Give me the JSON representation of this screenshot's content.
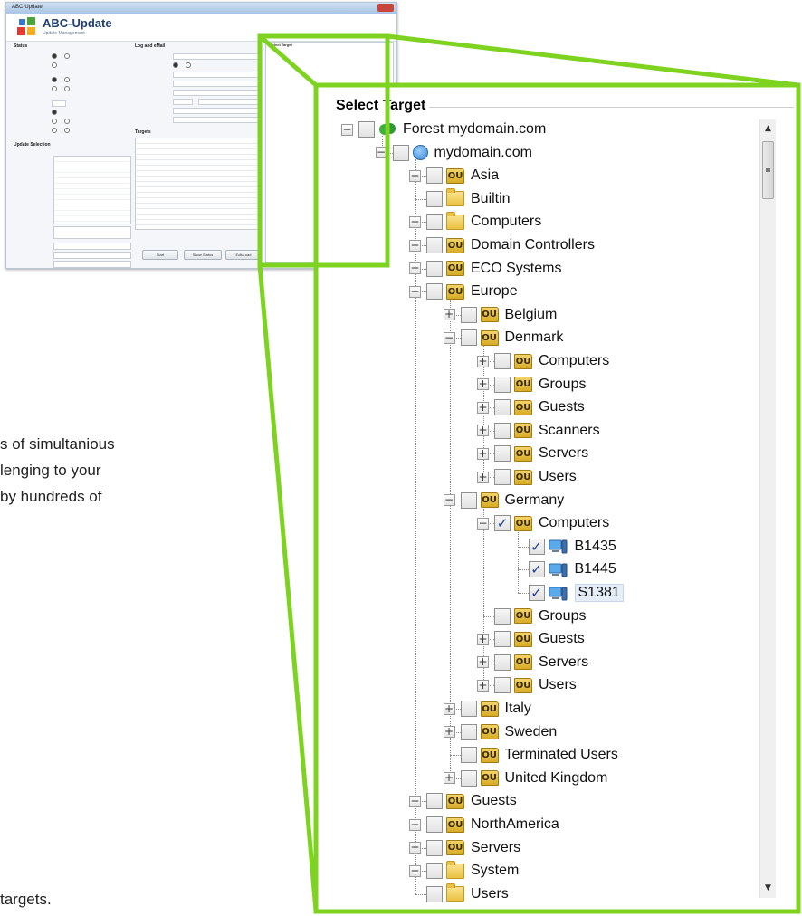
{
  "app": {
    "window_title": "ABC-Update",
    "title": "ABC-Update",
    "subtitle": "Update Management",
    "sections": {
      "status": "Status",
      "update_selection": "Update Selection",
      "log": "Log and eMail",
      "targets": "Targets",
      "target_tree": "Select Target"
    },
    "buttons": [
      "Start",
      "Show Status",
      "Edit/Load"
    ]
  },
  "background_text": {
    "line1": "s of simultanious",
    "line2": "lenging to your",
    "line3": "by hundreds of",
    "line4": "targets."
  },
  "panel": {
    "title": "Select Target"
  },
  "tree": [
    {
      "label": "Forest mydomain.com",
      "icon": "forest-tree-icon",
      "level": 0,
      "expander": "-",
      "checked": false
    },
    {
      "label": "mydomain.com",
      "icon": "domain-globe-icon",
      "level": 1,
      "expander": "-",
      "checked": false
    },
    {
      "label": "Asia",
      "icon": "ou-icon",
      "level": 2,
      "expander": "+",
      "checked": false
    },
    {
      "label": "Builtin",
      "icon": "folder-icon",
      "level": 2,
      "expander": "",
      "checked": false
    },
    {
      "label": "Computers",
      "icon": "folder-icon",
      "level": 2,
      "expander": "+",
      "checked": false
    },
    {
      "label": "Domain Controllers",
      "icon": "ou-icon",
      "level": 2,
      "expander": "+",
      "checked": false
    },
    {
      "label": "ECO Systems",
      "icon": "ou-icon",
      "level": 2,
      "expander": "+",
      "checked": false
    },
    {
      "label": "Europe",
      "icon": "ou-icon",
      "level": 2,
      "expander": "-",
      "checked": false
    },
    {
      "label": "Belgium",
      "icon": "ou-icon",
      "level": 3,
      "expander": "+",
      "checked": false
    },
    {
      "label": "Denmark",
      "icon": "ou-icon",
      "level": 3,
      "expander": "-",
      "checked": false
    },
    {
      "label": "Computers",
      "icon": "ou-icon",
      "level": 4,
      "expander": "+",
      "checked": false
    },
    {
      "label": "Groups",
      "icon": "ou-icon",
      "level": 4,
      "expander": "+",
      "checked": false
    },
    {
      "label": "Guests",
      "icon": "ou-icon",
      "level": 4,
      "expander": "+",
      "checked": false
    },
    {
      "label": "Scanners",
      "icon": "ou-icon",
      "level": 4,
      "expander": "+",
      "checked": false
    },
    {
      "label": "Servers",
      "icon": "ou-icon",
      "level": 4,
      "expander": "+",
      "checked": false
    },
    {
      "label": "Users",
      "icon": "ou-icon",
      "level": 4,
      "expander": "+",
      "checked": false
    },
    {
      "label": "Germany",
      "icon": "ou-icon",
      "level": 3,
      "expander": "-",
      "checked": false
    },
    {
      "label": "Computers",
      "icon": "ou-icon",
      "level": 4,
      "expander": "-",
      "checked": true
    },
    {
      "label": "B1435",
      "icon": "computer-icon",
      "level": 5,
      "expander": "",
      "checked": true
    },
    {
      "label": "B1445",
      "icon": "computer-icon",
      "level": 5,
      "expander": "",
      "checked": true
    },
    {
      "label": "S1381",
      "icon": "computer-icon",
      "level": 5,
      "expander": "",
      "checked": true,
      "selected": true
    },
    {
      "label": "Groups",
      "icon": "ou-icon",
      "level": 4,
      "expander": "",
      "checked": false
    },
    {
      "label": "Guests",
      "icon": "ou-icon",
      "level": 4,
      "expander": "+",
      "checked": false
    },
    {
      "label": "Servers",
      "icon": "ou-icon",
      "level": 4,
      "expander": "+",
      "checked": false
    },
    {
      "label": "Users",
      "icon": "ou-icon",
      "level": 4,
      "expander": "+",
      "checked": false
    },
    {
      "label": "Italy",
      "icon": "ou-icon",
      "level": 3,
      "expander": "+",
      "checked": false
    },
    {
      "label": "Sweden",
      "icon": "ou-icon",
      "level": 3,
      "expander": "+",
      "checked": false
    },
    {
      "label": "Terminated Users",
      "icon": "ou-icon",
      "level": 3,
      "expander": "",
      "checked": false
    },
    {
      "label": "United Kingdom",
      "icon": "ou-icon",
      "level": 3,
      "expander": "+",
      "checked": false
    },
    {
      "label": "Guests",
      "icon": "ou-icon",
      "level": 2,
      "expander": "+",
      "checked": false
    },
    {
      "label": "NorthAmerica",
      "icon": "ou-icon",
      "level": 2,
      "expander": "+",
      "checked": false
    },
    {
      "label": "Servers",
      "icon": "ou-icon",
      "level": 2,
      "expander": "+",
      "checked": false
    },
    {
      "label": "System",
      "icon": "folder-icon",
      "level": 2,
      "expander": "+",
      "checked": false
    },
    {
      "label": "Users",
      "icon": "folder-icon",
      "level": 2,
      "expander": "",
      "checked": false
    }
  ],
  "icons": {
    "ou_badge": "OU",
    "check": "✓",
    "scroll_up": "▲",
    "scroll_down": "▼"
  },
  "colors": {
    "callout_green": "#7ed321",
    "check_blue": "#1d3f9a",
    "selection_bg": "#e5eef8"
  }
}
